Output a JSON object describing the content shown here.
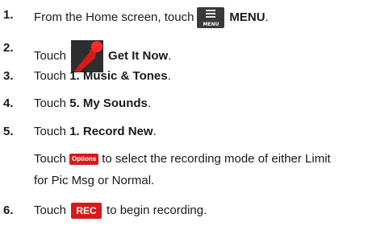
{
  "steps": [
    {
      "num": "1.",
      "before": "From the Home screen, touch",
      "icon": "menu-icon",
      "icon_label": "MENU",
      "bold": "MENU",
      "after": "."
    },
    {
      "num": "2.",
      "before": "Touch",
      "icon": "get-it-now-icon",
      "bold": "Get It Now",
      "after": "."
    },
    {
      "num": "3.",
      "before": "Touch",
      "bold": "1. Music & Tones",
      "after": "."
    },
    {
      "num": "4.",
      "before": "Touch",
      "bold": "5. My Sounds",
      "after": "."
    },
    {
      "num": "5.",
      "before": "Touch",
      "bold": "1. Record New",
      "after": "."
    },
    {
      "num": "6.",
      "before": "Touch",
      "button": "REC",
      "after": "to begin recording."
    }
  ],
  "note": {
    "before": "Touch",
    "button": "Options",
    "line1_after": "to select the recording mode of either Limit",
    "line2": "for Pic Msg or Normal."
  },
  "colors": {
    "accent_red": "#d61a1a",
    "icon_dark": "#3a3a3a"
  }
}
